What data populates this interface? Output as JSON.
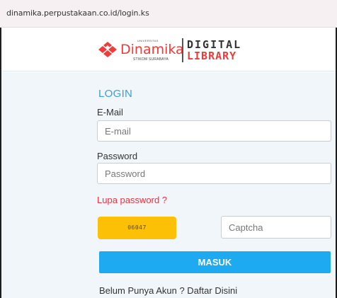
{
  "browser": {
    "url": "dinamika.perpustakaan.co.id/login.ks"
  },
  "logo": {
    "university_small": "UNIVERSITAS",
    "name": "Dinamika",
    "subtitle": "STIKOM SURABAYA",
    "digital": "DIGITAL",
    "library": "LIBRARY",
    "colors": {
      "red": "#ee3b3b",
      "dark": "#333333"
    }
  },
  "login": {
    "title": "LOGIN",
    "email_label": "E-Mail",
    "email_placeholder": "E-mail",
    "email_value": "",
    "password_label": "Password",
    "password_placeholder": "Password",
    "password_value": "",
    "forgot_label": "Lupa password ?",
    "captcha_code": "06047",
    "captcha_placeholder": "Captcha",
    "captcha_value": "",
    "submit_label": "MASUK",
    "register_text": "Belum Punya Akun ? Daftar Disini"
  },
  "colors": {
    "accent": "#1eaaf0",
    "title": "#3a9fd6",
    "link": "#e8343f",
    "captcha_bg": "#fcc106",
    "content_bg": "#f1f6fa"
  }
}
